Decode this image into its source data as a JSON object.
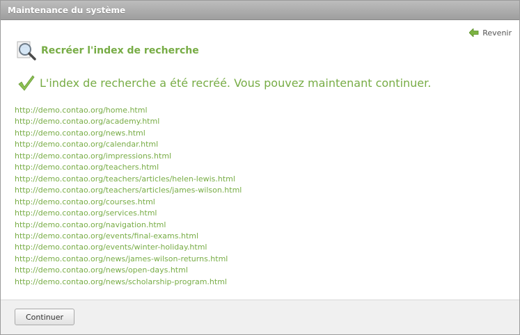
{
  "header": {
    "title": "Maintenance du système"
  },
  "back_link": {
    "label": "Revenir",
    "icon": "back-arrow-icon"
  },
  "section": {
    "title": "Recréer l'index de recherche",
    "icon": "search-magnifier-icon"
  },
  "confirmation": {
    "message": "L'index de recherche a été recréé. Vous pouvez maintenant continuer.",
    "icon": "checkmark-icon"
  },
  "urls": [
    "http://demo.contao.org/home.html",
    "http://demo.contao.org/academy.html",
    "http://demo.contao.org/news.html",
    "http://demo.contao.org/calendar.html",
    "http://demo.contao.org/impressions.html",
    "http://demo.contao.org/teachers.html",
    "http://demo.contao.org/teachers/articles/helen-lewis.html",
    "http://demo.contao.org/teachers/articles/james-wilson.html",
    "http://demo.contao.org/courses.html",
    "http://demo.contao.org/services.html",
    "http://demo.contao.org/navigation.html",
    "http://demo.contao.org/events/final-exams.html",
    "http://demo.contao.org/events/winter-holiday.html",
    "http://demo.contao.org/news/james-wilson-returns.html",
    "http://demo.contao.org/news/open-days.html",
    "http://demo.contao.org/news/scholarship-program.html"
  ],
  "footer": {
    "continue_label": "Continuer"
  },
  "colors": {
    "accent": "#77ac45",
    "header_bg": "#a8a8a8",
    "footer_bg": "#f0f0f0"
  }
}
